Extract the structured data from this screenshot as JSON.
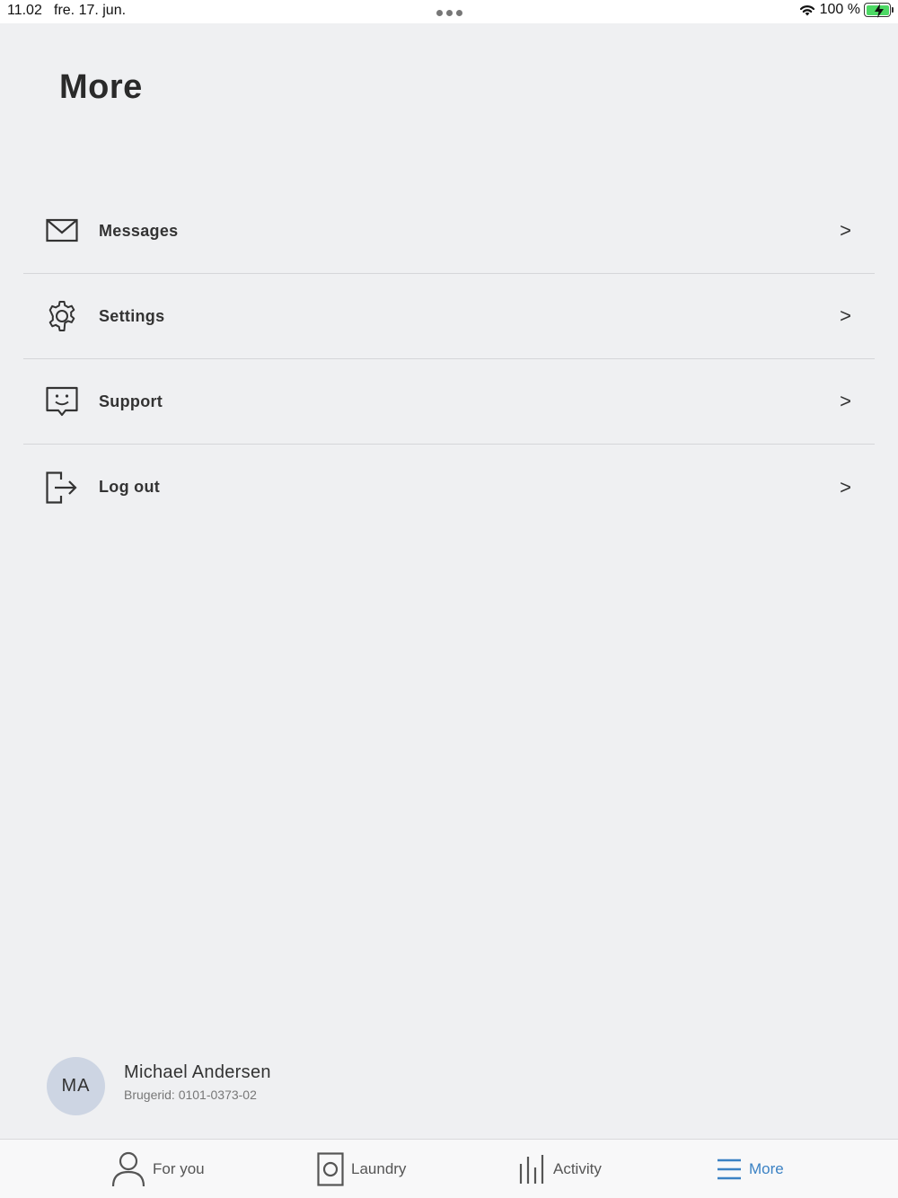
{
  "status_bar": {
    "time": "11.02",
    "date": "fre. 17. jun.",
    "battery": "100 %"
  },
  "page": {
    "title": "More"
  },
  "menu": {
    "items": [
      {
        "label": "Messages",
        "icon": "envelope-icon",
        "chevron": ">"
      },
      {
        "label": "Settings",
        "icon": "gear-icon",
        "chevron": ">"
      },
      {
        "label": "Support",
        "icon": "support-chat-icon",
        "chevron": ">"
      },
      {
        "label": "Log out",
        "icon": "logout-icon",
        "chevron": ">"
      }
    ]
  },
  "profile": {
    "initials": "MA",
    "name": "Michael Andersen",
    "user_id": "Brugerid: 0101-0373-02"
  },
  "tab_bar": {
    "tabs": [
      {
        "label": "For you",
        "icon": "person-icon",
        "active": false
      },
      {
        "label": "Laundry",
        "icon": "washing-machine-icon",
        "active": false
      },
      {
        "label": "Activity",
        "icon": "bars-icon",
        "active": false
      },
      {
        "label": "More",
        "icon": "menu-icon",
        "active": true
      }
    ]
  },
  "colors": {
    "background": "#eff0f2",
    "accent": "#3b82c4",
    "battery_fill": "#4cd964",
    "avatar_bg": "#cdd5e3"
  }
}
